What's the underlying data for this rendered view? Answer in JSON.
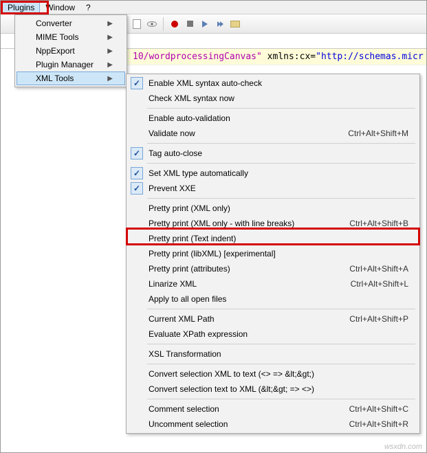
{
  "menubar": {
    "plugins": "Plugins",
    "window": "Window",
    "help": "?"
  },
  "code": {
    "seg1": "10/wordprocessingCanvas\"",
    "seg2": " xmlns:cx",
    "seg3": "=",
    "seg4": "\"http://schemas.micr"
  },
  "menu1": {
    "converter": "Converter",
    "mime": "MIME Tools",
    "nppexport": "NppExport",
    "pluginmgr": "Plugin Manager",
    "xmltools": "XML Tools"
  },
  "menu2": {
    "enable_auto": "Enable XML syntax auto-check",
    "check_now": "Check XML syntax now",
    "enable_autoval": "Enable auto-validation",
    "validate_now": "Validate now",
    "validate_now_sc": "Ctrl+Alt+Shift+M",
    "tag_auto": "Tag auto-close",
    "set_xml": "Set XML type automatically",
    "prevent_xxe": "Prevent XXE",
    "pp_xml": "Pretty print (XML only)",
    "pp_xml_lb": "Pretty print (XML only - with line breaks)",
    "pp_xml_lb_sc": "Ctrl+Alt+Shift+B",
    "pp_text": "Pretty print (Text indent)",
    "pp_lib": "Pretty print (libXML) [experimental]",
    "pp_attr": "Pretty print (attributes)",
    "pp_attr_sc": "Ctrl+Alt+Shift+A",
    "linarize": "Linarize XML",
    "linarize_sc": "Ctrl+Alt+Shift+L",
    "apply_all": "Apply to all open files",
    "cur_xpath": "Current XML Path",
    "cur_xpath_sc": "Ctrl+Alt+Shift+P",
    "eval_xpath": "Evaluate XPath expression",
    "xsl": "XSL Transformation",
    "conv_x2t": "Convert selection XML to text (<> => &lt;&gt;)",
    "conv_t2x": "Convert selection text to XML (&lt;&gt; => <>)",
    "comment": "Comment selection",
    "comment_sc": "Ctrl+Alt+Shift+C",
    "uncomment": "Uncomment selection",
    "uncomment_sc": "Ctrl+Alt+Shift+R"
  },
  "watermark": "wsxdn.com"
}
